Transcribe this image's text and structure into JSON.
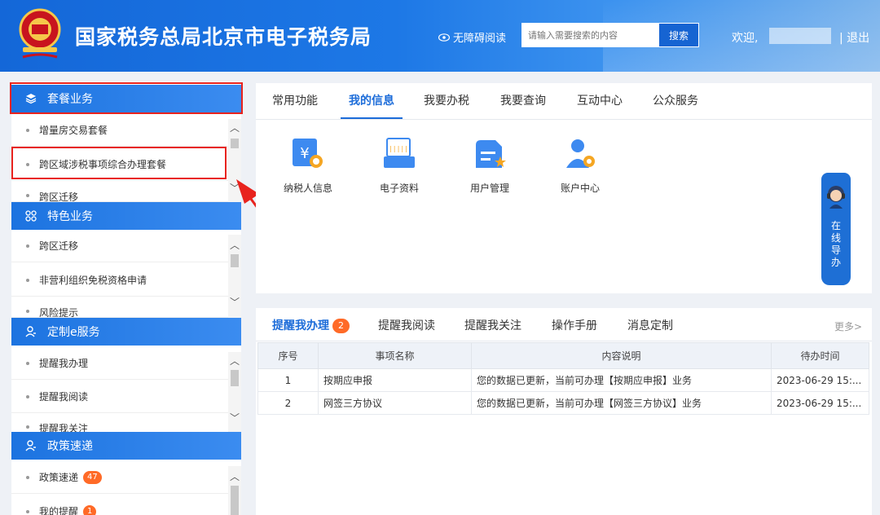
{
  "header": {
    "site_title": "国家税务总局北京市电子税务局",
    "a11y_label": "无障碍阅读",
    "search_placeholder": "请输入需要搜索的内容",
    "search_button": "搜索",
    "welcome": "欢迎,",
    "logout": "| 退出"
  },
  "sidebar": {
    "sections": [
      {
        "title": "套餐业务",
        "icon": "layers-icon",
        "items": [
          "增量房交易套餐",
          "跨区域涉税事项综合办理套餐",
          "跨区迁移"
        ]
      },
      {
        "title": "特色业务",
        "icon": "grid-icon",
        "items": [
          "跨区迁移",
          "非营利组织免税资格申请",
          "风险提示"
        ]
      },
      {
        "title": "定制e服务",
        "icon": "user-icon",
        "items": [
          "提醒我办理",
          "提醒我阅读",
          "提醒我关注"
        ]
      },
      {
        "title": "政策速递",
        "icon": "user-icon",
        "items": [
          "政策速递",
          "我的提醒"
        ],
        "badges": [
          "47",
          "1"
        ]
      }
    ]
  },
  "func_panel": {
    "tabs": [
      "常用功能",
      "我的信息",
      "我要办税",
      "我要查询",
      "互动中心",
      "公众服务"
    ],
    "active_tab": "我的信息",
    "functions": [
      {
        "label": "纳税人信息",
        "icon": "taxpayer-info-icon"
      },
      {
        "label": "电子资料",
        "icon": "e-documents-icon"
      },
      {
        "label": "用户管理",
        "icon": "user-management-icon"
      },
      {
        "label": "账户中心",
        "icon": "account-center-icon"
      }
    ]
  },
  "guide": {
    "text": "在线导办"
  },
  "notice_panel": {
    "tabs": [
      "提醒我办理",
      "提醒我阅读",
      "提醒我关注",
      "操作手册",
      "消息定制"
    ],
    "active_tab": "提醒我办理",
    "count": "2",
    "more": "更多>",
    "columns": [
      "序号",
      "事项名称",
      "内容说明",
      "待办时间"
    ],
    "rows": [
      {
        "no": "1",
        "name": "按期应申报",
        "desc": "您的数据已更新，当前可办理【按期应申报】业务",
        "time": "2023-06-29 15:..."
      },
      {
        "no": "2",
        "name": "网签三方协议",
        "desc": "您的数据已更新，当前可办理【网签三方协议】业务",
        "time": "2023-06-29 15:..."
      }
    ]
  },
  "colors": {
    "primary": "#1c6cd9",
    "badge": "#ff6a27",
    "highlight": "#e8231e"
  }
}
